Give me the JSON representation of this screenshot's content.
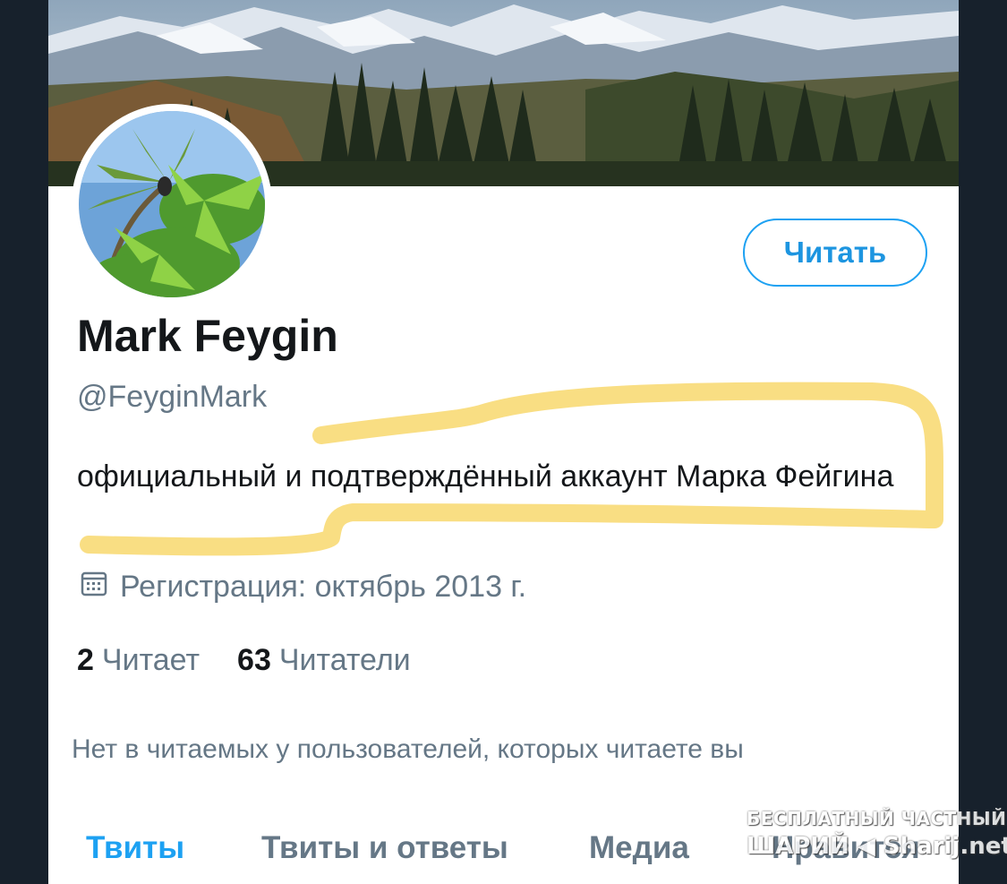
{
  "profile": {
    "display_name": "Mark Feygin",
    "handle": "@FeyginMark",
    "bio": "официальный и подтверждённый аккаунт Марка Фейгина",
    "joined": "Регистрация: октябрь 2013 г.",
    "follow_button_label": "Читать"
  },
  "stats": {
    "following_count": "2",
    "following_label": "Читает",
    "followers_count": "63",
    "followers_label": "Читатели"
  },
  "followed_by_text": "Нет в читаемых у пользователей, которых читаете вы",
  "tabs": [
    {
      "label": "Твиты",
      "active": true
    },
    {
      "label": "Твиты и ответы",
      "active": false
    },
    {
      "label": "Медиа",
      "active": false
    },
    {
      "label": "Нравится",
      "active": false
    }
  ],
  "watermark": {
    "line1": "БЕСПЛАТНЫЙ ЧАСТНЫЙ",
    "line2": "ШАРИЙ ◀ Sharij.net"
  },
  "icons": {
    "joined": "calendar-icon"
  },
  "colors": {
    "accent": "#1da1f2",
    "secondary_text": "#657786",
    "primary_text": "#14171a",
    "highlight": "#f7d35a",
    "frame": "#15202b"
  }
}
